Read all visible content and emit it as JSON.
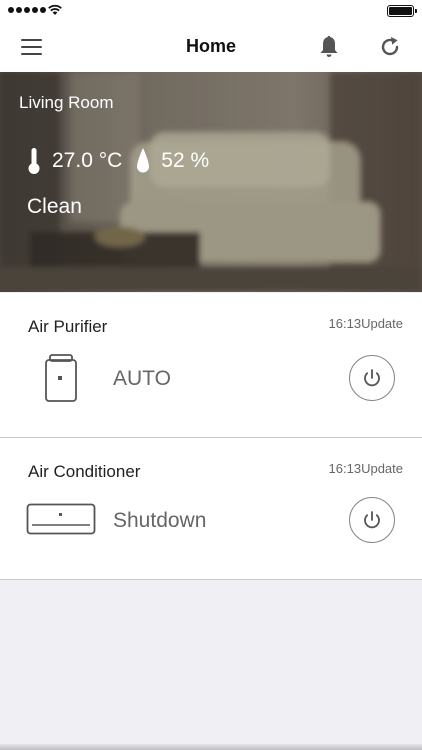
{
  "nav": {
    "title": "Home",
    "menu_icon": "hamburger-menu-icon",
    "notification_icon": "bell-icon",
    "refresh_icon": "refresh-icon"
  },
  "room": {
    "name": "Living Room",
    "temperature": "27.0 °C",
    "humidity": "52 %",
    "air_quality": "Clean"
  },
  "devices": [
    {
      "name": "Air Purifier",
      "updated": "16:13Update",
      "state": "AUTO",
      "icon": "air-purifier-icon",
      "power_icon": "power-icon"
    },
    {
      "name": "Air Conditioner",
      "updated": "16:13Update",
      "state": "Shutdown",
      "icon": "air-conditioner-icon",
      "power_icon": "power-icon"
    }
  ],
  "colors": {
    "background": "#efeff4",
    "card": "#ffffff",
    "text_primary": "#222222",
    "text_secondary": "#666666",
    "hero_text": "#ffffff"
  }
}
